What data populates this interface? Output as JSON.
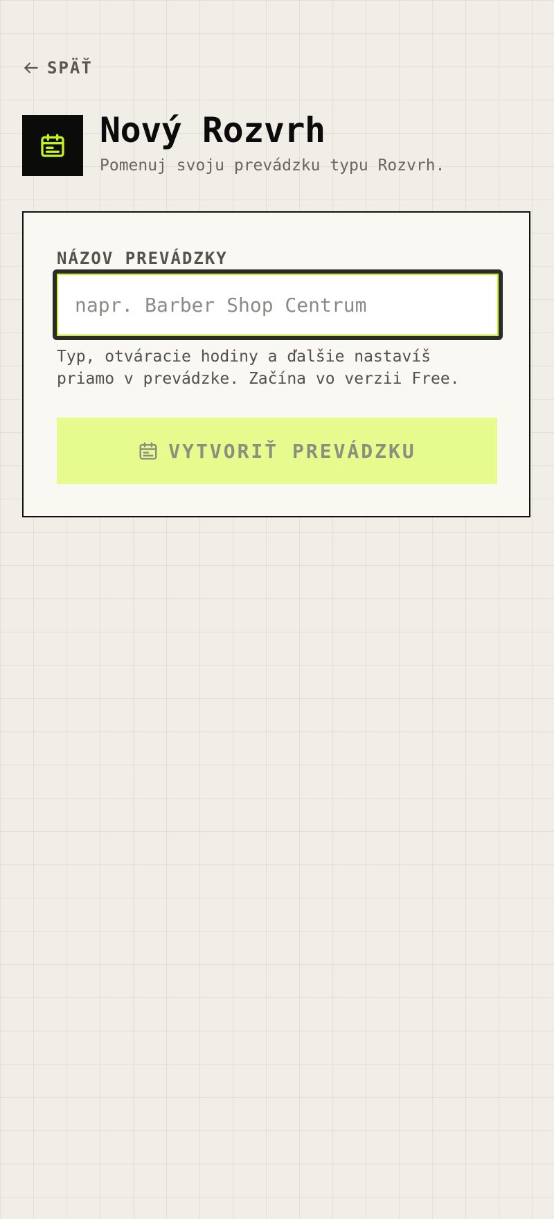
{
  "navigation": {
    "back_label": "SPÄŤ",
    "back_icon": "arrow-left-icon"
  },
  "header": {
    "icon": "calendar-icon",
    "title": "Nový Rozvrh",
    "subtitle": "Pomenuj svoju prevádzku typu Rozvrh."
  },
  "form": {
    "field_label": "NÁZOV PREVÁDZKY",
    "input": {
      "value": "",
      "placeholder": "napr. Barber Shop Centrum"
    },
    "helper_lines": [
      "Typ, otváracie hodiny a ďalšie nastavíš",
      "priamo v prevádzke. Začína vo verzii Free."
    ],
    "submit": {
      "label": "VYTVORIŤ PREVÁDZKU",
      "icon": "calendar-icon"
    }
  },
  "colors": {
    "background": "#f1eee7",
    "accent": "#c6f21e",
    "button_fill": "#e5fb8d",
    "dark": "#0b0c0a"
  }
}
